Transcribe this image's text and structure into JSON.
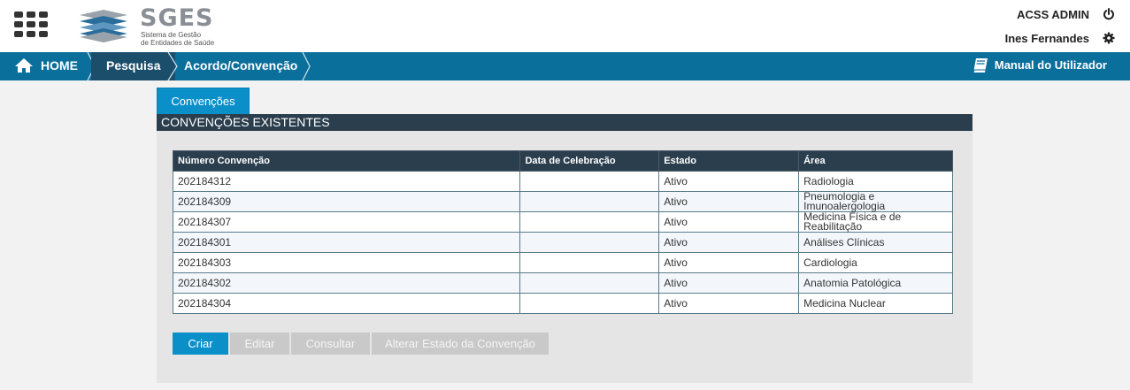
{
  "header": {
    "logo": {
      "title": "SGES",
      "subtitle_line1": "Sistema de Gestão",
      "subtitle_line2": "de Entidades de Saúde"
    },
    "user_role": "ACSS ADMIN",
    "user_name": "Ines Fernandes",
    "icons": [
      "apps-grid-icon",
      "power-icon",
      "gear-icon"
    ]
  },
  "nav": {
    "breadcrumbs": [
      "HOME",
      "Pesquisa",
      "Acordo/Convenção"
    ],
    "manual_label": "Manual do Utilizador",
    "colors": {
      "bar": "#0b6f9c",
      "active": "#1a4e6b"
    }
  },
  "tabs": [
    {
      "label": "Convenções",
      "active": true
    }
  ],
  "panel": {
    "title": "CONVENÇÕES EXISTENTES",
    "table": {
      "columns": [
        "Número Convenção",
        "Data de Celebração",
        "Estado",
        "Área"
      ],
      "rows": [
        [
          "202184312",
          "",
          "Ativo",
          "Radiologia"
        ],
        [
          "202184309",
          "",
          "Ativo",
          "Pneumologia e Imunoalergologia"
        ],
        [
          "202184307",
          "",
          "Ativo",
          "Medicina Física e de Reabilitação"
        ],
        [
          "202184301",
          "",
          "Ativo",
          "Análises Clínicas"
        ],
        [
          "202184303",
          "",
          "Ativo",
          "Cardiologia"
        ],
        [
          "202184302",
          "",
          "Ativo",
          "Anatomia Patológica"
        ],
        [
          "202184304",
          "",
          "Ativo",
          "Medicina Nuclear"
        ]
      ]
    },
    "actions": [
      {
        "label": "Criar",
        "enabled": true
      },
      {
        "label": "Editar",
        "enabled": false
      },
      {
        "label": "Consultar",
        "enabled": false
      },
      {
        "label": "Alterar Estado da Convenção",
        "enabled": false
      }
    ]
  }
}
